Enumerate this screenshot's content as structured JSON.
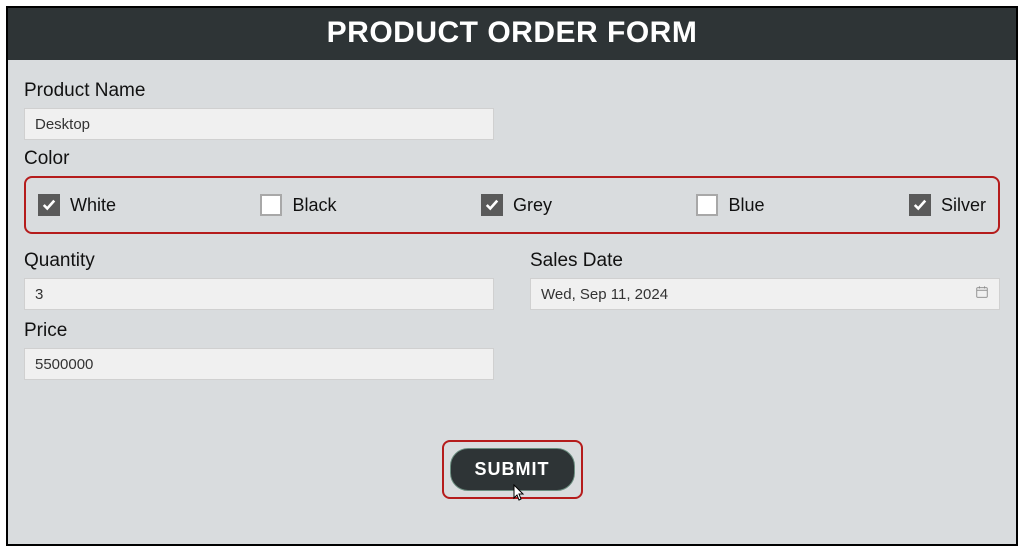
{
  "header": {
    "title": "PRODUCT ORDER FORM"
  },
  "fields": {
    "productName": {
      "label": "Product Name",
      "value": "Desktop"
    },
    "color": {
      "label": "Color",
      "options": [
        {
          "label": "White",
          "checked": true
        },
        {
          "label": "Black",
          "checked": false
        },
        {
          "label": "Grey",
          "checked": true
        },
        {
          "label": "Blue",
          "checked": false
        },
        {
          "label": "Silver",
          "checked": true
        }
      ]
    },
    "quantity": {
      "label": "Quantity",
      "value": "3"
    },
    "salesDate": {
      "label": "Sales Date",
      "value": "Wed, Sep 11, 2024"
    },
    "price": {
      "label": "Price",
      "value": "5500000"
    }
  },
  "actions": {
    "submit": "SUBMIT"
  },
  "highlightColor": "#b51c1c"
}
